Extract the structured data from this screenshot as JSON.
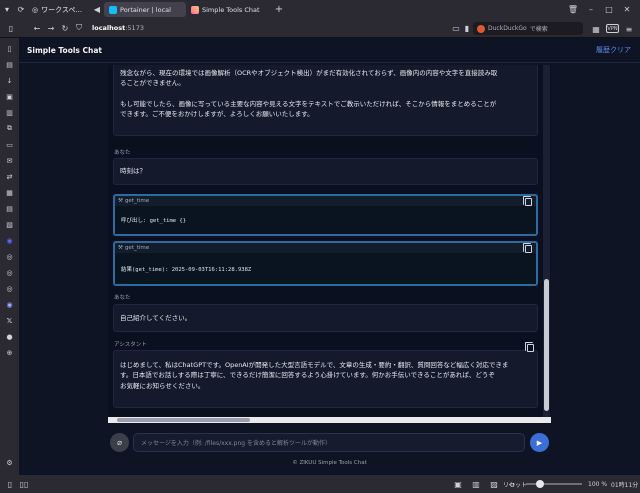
{
  "browser": {
    "workspace_label": "ワークスペ...",
    "tabs": [
      {
        "title": "Portainer | local",
        "active": true
      },
      {
        "title": "Simple Tools Chat",
        "active": false
      }
    ],
    "url_host": "localhost",
    "url_port": ":5173",
    "search_engine": "DuckDuckGo",
    "search_suffix": "で検索",
    "zoom_reset": "リセット",
    "zoom_level": "100 %",
    "clock": "01時11分"
  },
  "app": {
    "title": "Simple Tools Chat",
    "clear_label": "履歴クリア",
    "footer": "© ZIKUU Simple Tools Chat"
  },
  "messages": {
    "m1": {
      "p1_line1": "残念ながら、現在の環境では画像解析（OCRやオブジェクト検出）がまだ有効化されておらず、画像内の内容や文字を直接読み取",
      "p1_line2": "ることができません。",
      "p2_line1": "もし可能でしたら、画像に写っている主要な内容や見える文字をテキストでご教示いただければ、そこから情報をまとめることが",
      "p2_line2": "できます。ご不便をおかけしますが、よろしくお願いいたします。"
    },
    "m2": {
      "role": "あなた",
      "text": "時刻は？"
    },
    "tool1": {
      "name": "get_time",
      "body": "呼び出し: get_time {}"
    },
    "tool2": {
      "name": "get_time",
      "body": "結果(get_time): 2025-09-03T16:11:28.938Z"
    },
    "m3": {
      "role": "あなた",
      "text": "自己紹介してください。"
    },
    "m4": {
      "role": "アシスタント",
      "line1": "はじめまして、私はChatGPTです。OpenAIが開発した大型言語モデルで、文章の生成・要約・翻訳、質問回答など幅広く対応できま",
      "line2": "す。日本語でお話しする際は丁寧に、できるだけ簡潔に回答するよう心掛けています。何かお手伝いできることがあれば、どうぞ",
      "line3": "お気軽にお知らせください。"
    }
  },
  "composer": {
    "placeholder": "メッセージを入力（例: /files/xxx.png を含めると解析ツールが動作）"
  },
  "colors": {
    "accent": "#3c6fd6",
    "link": "#5d8df0",
    "tool_border": "#2f6aa0"
  }
}
